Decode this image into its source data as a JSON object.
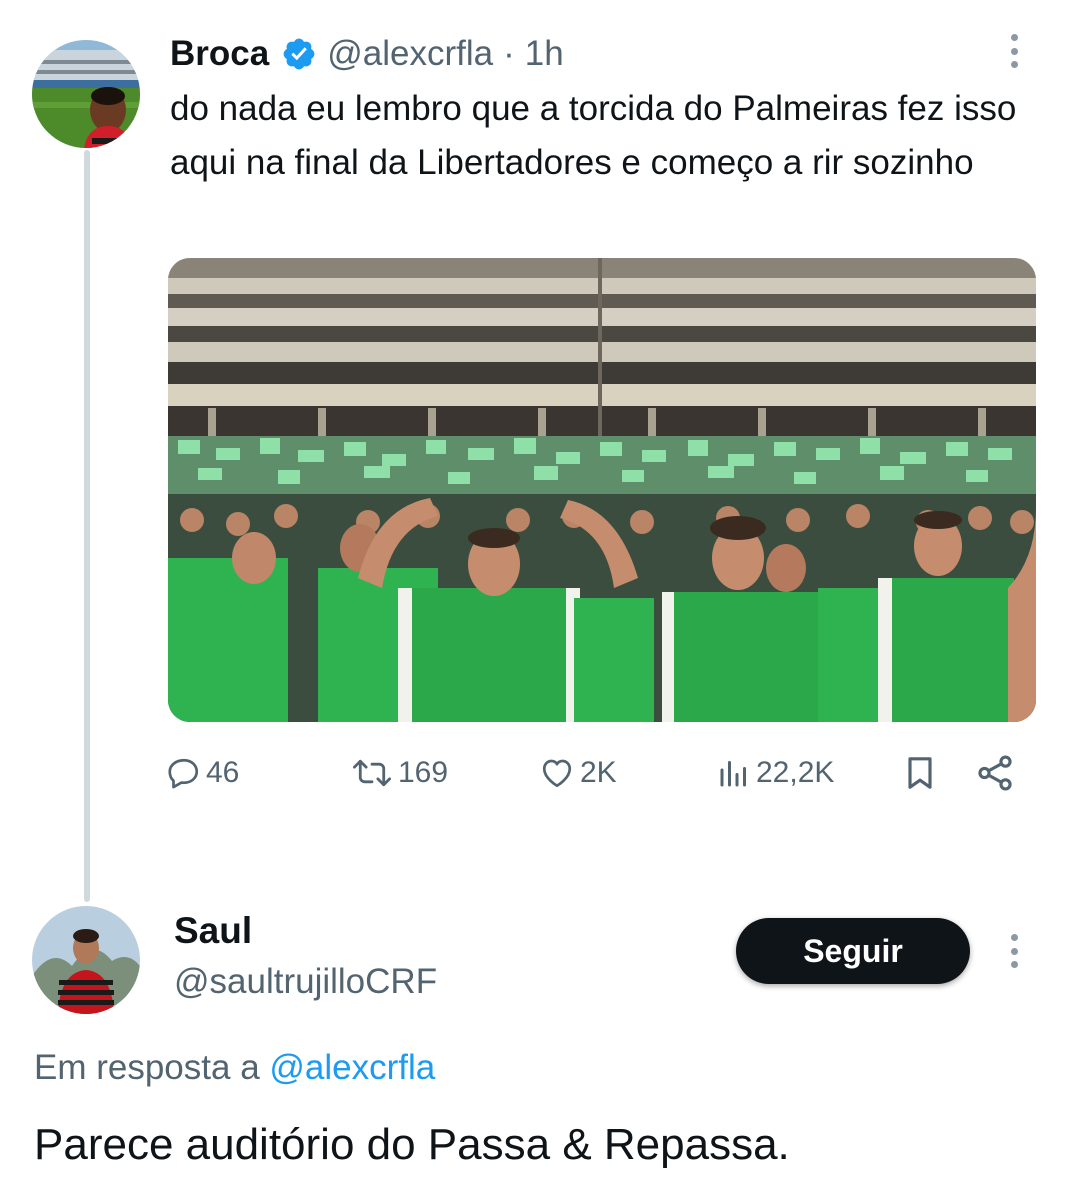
{
  "tweet": {
    "author": {
      "display_name": "Broca",
      "handle": "@alexcrfla",
      "verified": true,
      "avatar_icon": "profile-photo-player-in-stadium"
    },
    "separator": "·",
    "time": "1h",
    "text": "do nada eu lembro que a torcida do Palmeiras fez isso aqui na final da Libertadores e começo a rir sozinho",
    "media": {
      "description_icon": "video-crowd-green-bibs"
    },
    "actions": {
      "replies": "46",
      "retweets": "169",
      "likes": "2K",
      "views": "22,2K"
    }
  },
  "reply": {
    "author": {
      "display_name": "Saul",
      "handle": "@saultrujilloCRF",
      "avatar_icon": "profile-photo-man-in-flamengo-shirt"
    },
    "follow_label": "Seguir",
    "reply_prefix": "Em resposta a",
    "reply_to_handle": "@alexcrfla",
    "text": "Parece auditório do Passa & Repassa."
  },
  "colors": {
    "text_primary": "#0f1419",
    "text_secondary": "#536471",
    "link": "#1d9bf0",
    "verified_badge": "#1d9bf0",
    "thread_line": "#cfd9de",
    "follow_button_bg": "#0f1419",
    "crowd_green": "#2fb350"
  }
}
